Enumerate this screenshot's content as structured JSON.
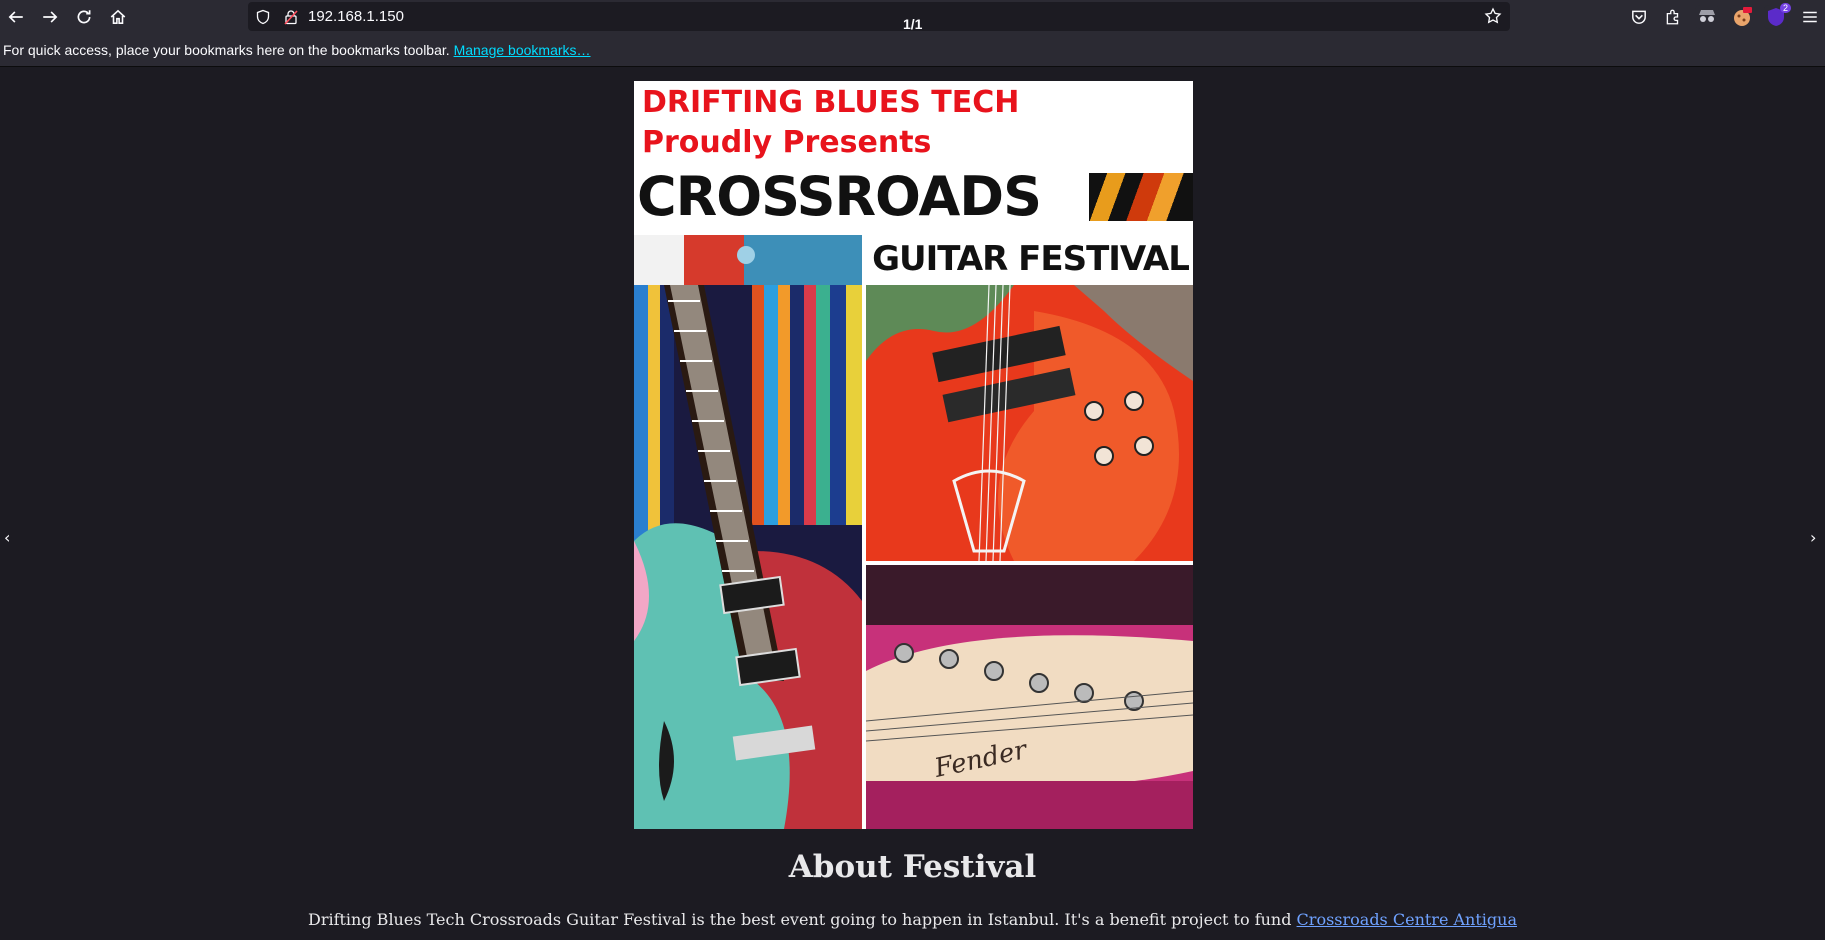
{
  "browser": {
    "url": "192.168.1.150",
    "page_count": "1/1",
    "extension_badge": "2"
  },
  "bookmarks_bar": {
    "hint": "For quick access, place your bookmarks here on the bookmarks toolbar.",
    "manage_link": "Manage bookmarks…"
  },
  "poster": {
    "line1": "DRIFTING BLUES TECH",
    "line2": "Proudly Presents",
    "line3": "CROSSROADS",
    "line4": "GUITAR FESTIVAL",
    "guitar_brand": "Fender"
  },
  "about": {
    "heading": "About Festival",
    "text": "Drifting Blues Tech Crossroads Guitar Festival is the best event going to happen in Istanbul. It's a benefit project to fund ",
    "link": "Crossroads Centre Antigua"
  },
  "colors": {
    "poster_red": "#e8131c",
    "link_blue": "#6fa2ff",
    "bookmark_link": "#00ddff"
  }
}
